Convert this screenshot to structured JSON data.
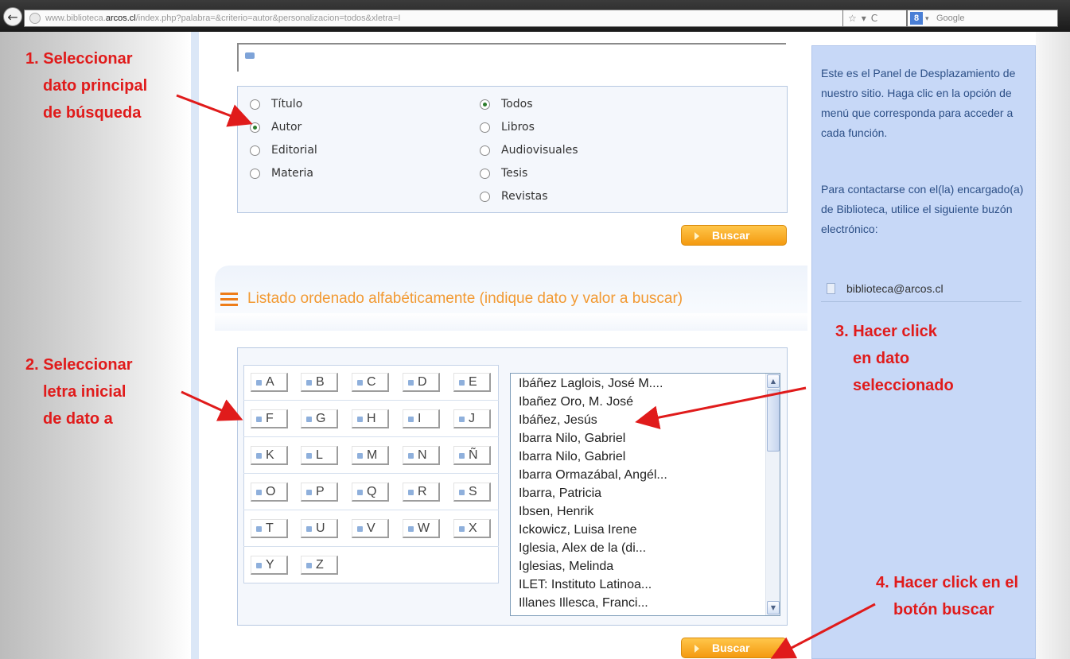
{
  "browser": {
    "url_prefix": "www.biblioteca.",
    "url_host": "arcos.cl",
    "url_path": "/index.php?palabra=&criterio=autor&personalizacion=todos&xletra=I",
    "search_engine": "Google"
  },
  "criteria": {
    "fields": [
      {
        "label": "Título",
        "selected": false
      },
      {
        "label": "Autor",
        "selected": true
      },
      {
        "label": "Editorial",
        "selected": false
      },
      {
        "label": "Materia",
        "selected": false
      }
    ],
    "types": [
      {
        "label": "Todos",
        "selected": true
      },
      {
        "label": "Libros",
        "selected": false
      },
      {
        "label": "Audiovisuales",
        "selected": false
      },
      {
        "label": "Tesis",
        "selected": false
      },
      {
        "label": "Revistas",
        "selected": false
      }
    ]
  },
  "buttons": {
    "buscar": "Buscar"
  },
  "section": {
    "title": "Listado ordenado alfabéticamente (indique dato y valor a buscar)"
  },
  "letters": [
    "A",
    "B",
    "C",
    "D",
    "E",
    "F",
    "G",
    "H",
    "I",
    "J",
    "K",
    "L",
    "M",
    "N",
    "Ñ",
    "O",
    "P",
    "Q",
    "R",
    "S",
    "T",
    "U",
    "V",
    "W",
    "X",
    "Y",
    "Z"
  ],
  "results": [
    "Ibáñez Laglois, José M....",
    "Ibañez Oro, M. José",
    "Ibáñez, Jesús",
    "Ibarra Nilo, Gabriel",
    "Ibarra Nilo, Gabriel",
    "Ibarra Ormazábal, Angél...",
    "Ibarra, Patricia",
    "Ibsen, Henrik",
    "Ickowicz, Luisa Irene",
    "Iglesia, Alex de la (di...",
    "Iglesias, Melinda",
    "ILET: Instituto Latinoa...",
    "Illanes Illesca, Franci..."
  ],
  "panel": {
    "intro": "Este es el Panel de Desplazamiento de nuestro sitio. Haga clic en la opción de menú que corresponda para acceder a cada función.",
    "contact": "Para contactarse con el(la) encargado(a) de Biblioteca, utilice el siguiente buzón electrónico:",
    "email": "biblioteca@arcos.cl"
  },
  "annotations": {
    "step1": [
      "1. Seleccionar",
      "dato principal",
      "de búsqueda"
    ],
    "step2": [
      "2. Seleccionar",
      "letra inicial",
      "de dato a"
    ],
    "step3": [
      "3. Hacer click",
      "en dato",
      "seleccionado"
    ],
    "step4": [
      "4. Hacer click en el",
      "botón buscar"
    ]
  },
  "colors": {
    "annotation": "#e01b1b",
    "button_orange": "#f49a10",
    "section_title": "#f29a33",
    "panel_bg": "#c7d8f7",
    "panel_text": "#2c4f86"
  }
}
